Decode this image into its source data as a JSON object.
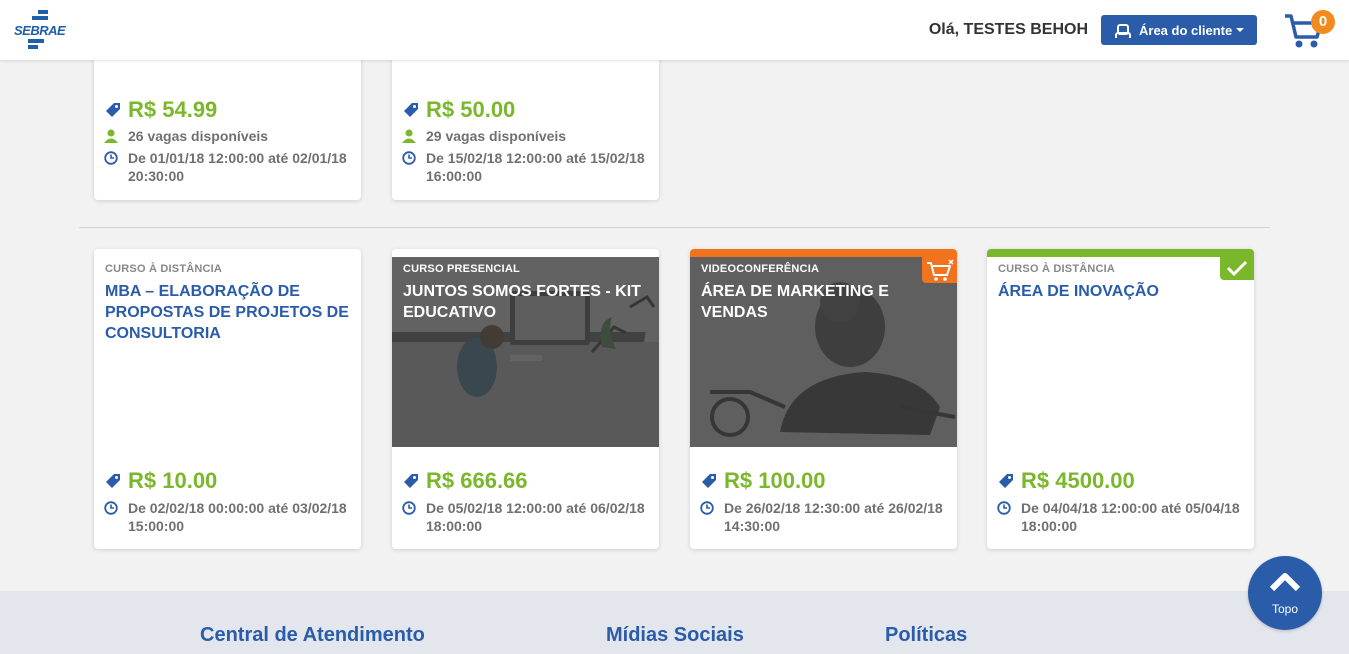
{
  "header": {
    "logo_text": "SEBRAE",
    "greeting": "Olá, TESTES BEHOH",
    "client_button": "Área do cliente",
    "cart_count": "0"
  },
  "top_cards": [
    {
      "price": "R$ 54.99",
      "vagas": "26 vagas disponíveis",
      "dates": "De 01/01/18 12:00:00 até 02/01/18 20:30:00"
    },
    {
      "price": "R$ 50.00",
      "vagas": "29 vagas disponíveis",
      "dates": "De 15/02/18 12:00:00 até 15/02/18 16:00:00"
    }
  ],
  "cards": [
    {
      "kind": "CURSO À DISTÂNCIA",
      "title": "MBA – ELABORAÇÃO DE PROPOSTAS DE PROJETOS DE CONSULTORIA",
      "price": "R$ 10.00",
      "dates": "De 02/02/18 00:00:00 até 03/02/18 15:00:00"
    },
    {
      "kind": "CURSO PRESENCIAL",
      "title": "JUNTOS SOMOS FORTES - KIT EDUCATIVO",
      "price": "R$ 666.66",
      "dates": "De 05/02/18 12:00:00 até 06/02/18 18:00:00"
    },
    {
      "kind": "VIDEOCONFERÊNCIA",
      "title": "ÁREA DE MARKETING E VENDAS",
      "price": "R$ 100.00",
      "dates": "De 26/02/18 12:30:00 até 26/02/18 14:30:00"
    },
    {
      "kind": "CURSO À DISTÂNCIA",
      "title": "ÁREA DE INOVAÇÃO",
      "price": "R$ 4500.00",
      "dates": "De 04/04/18 12:00:00 até 05/04/18 18:00:00"
    }
  ],
  "footer": {
    "col1": "Central de Atendimento",
    "col2": "Mídias Sociais",
    "col3": "Políticas"
  },
  "topo_label": "Topo",
  "colors": {
    "brand_blue": "#2a5caa",
    "price_green": "#7ab72a",
    "orange": "#f2731e",
    "check_green": "#7ab72a"
  },
  "icons": [
    "tag-icon",
    "person-icon",
    "clock-icon",
    "cart-icon",
    "user-icon",
    "check-icon",
    "chevron-up-icon"
  ]
}
